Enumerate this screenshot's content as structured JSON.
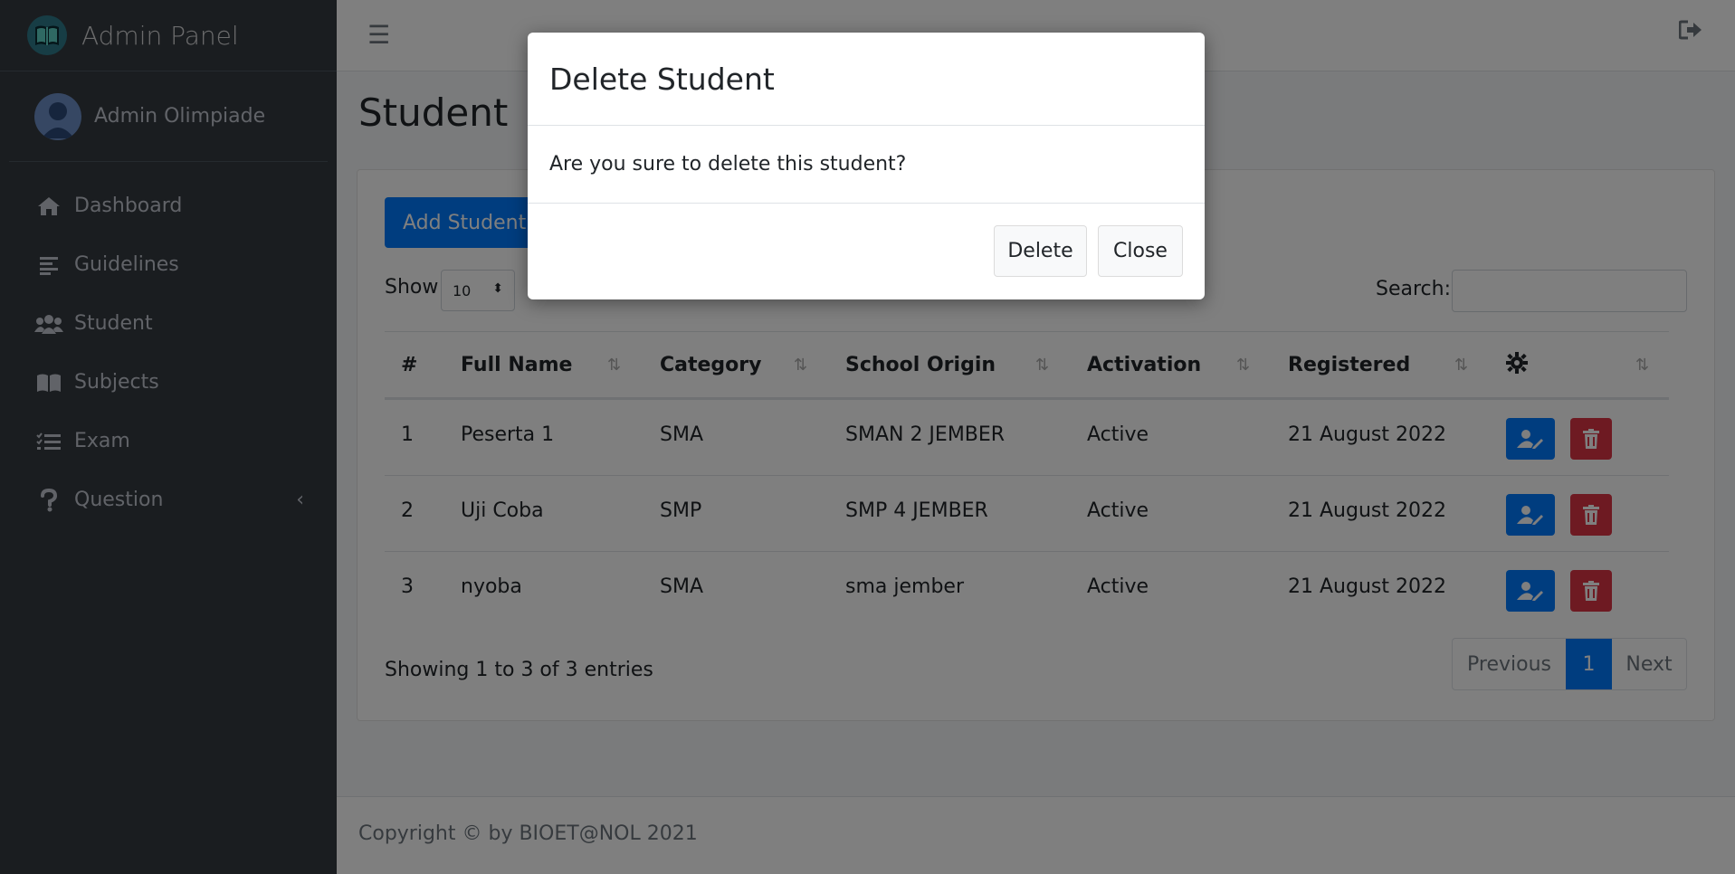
{
  "brand": {
    "title": "Admin Panel"
  },
  "user": {
    "name": "Admin Olimpiade"
  },
  "nav": {
    "items": [
      {
        "label": "Dashboard",
        "icon": "home-icon"
      },
      {
        "label": "Guidelines",
        "icon": "align-left-icon"
      },
      {
        "label": "Student",
        "icon": "users-icon"
      },
      {
        "label": "Subjects",
        "icon": "book-icon"
      },
      {
        "label": "Exam",
        "icon": "list-check-icon"
      },
      {
        "label": "Question",
        "icon": "question-icon",
        "caret": "‹"
      }
    ]
  },
  "page": {
    "title": "Student"
  },
  "toolbar": {
    "add_label": "Add Student",
    "show_label": "Show",
    "show_value": "10",
    "search_label": "Search:"
  },
  "table": {
    "headers": [
      "#",
      "Full Name",
      "Category",
      "School Origin",
      "Activation",
      "Registered"
    ],
    "rows": [
      [
        "1",
        "Peserta 1",
        "SMA",
        "SMAN 2 JEMBER",
        "Active",
        "21 August 2022"
      ],
      [
        "2",
        "Uji Coba",
        "SMP",
        "SMP 4 JEMBER",
        "Active",
        "21 August 2022"
      ],
      [
        "3",
        "nyoba",
        "SMA",
        "sma jember",
        "Active",
        "21 August 2022"
      ]
    ]
  },
  "info": {
    "showing": "Showing 1 to 3 of 3 entries"
  },
  "pagination": {
    "previous": "Previous",
    "current": "1",
    "next": "Next"
  },
  "footer": {
    "text": "Copyright © by BIOET@NOL 2021"
  },
  "modal": {
    "title": "Delete Student",
    "body": "Are you sure to delete this student?",
    "delete_label": "Delete",
    "close_label": "Close"
  },
  "colors": {
    "primary": "#007bff",
    "danger": "#dc3545",
    "sidebar": "#343a40"
  }
}
